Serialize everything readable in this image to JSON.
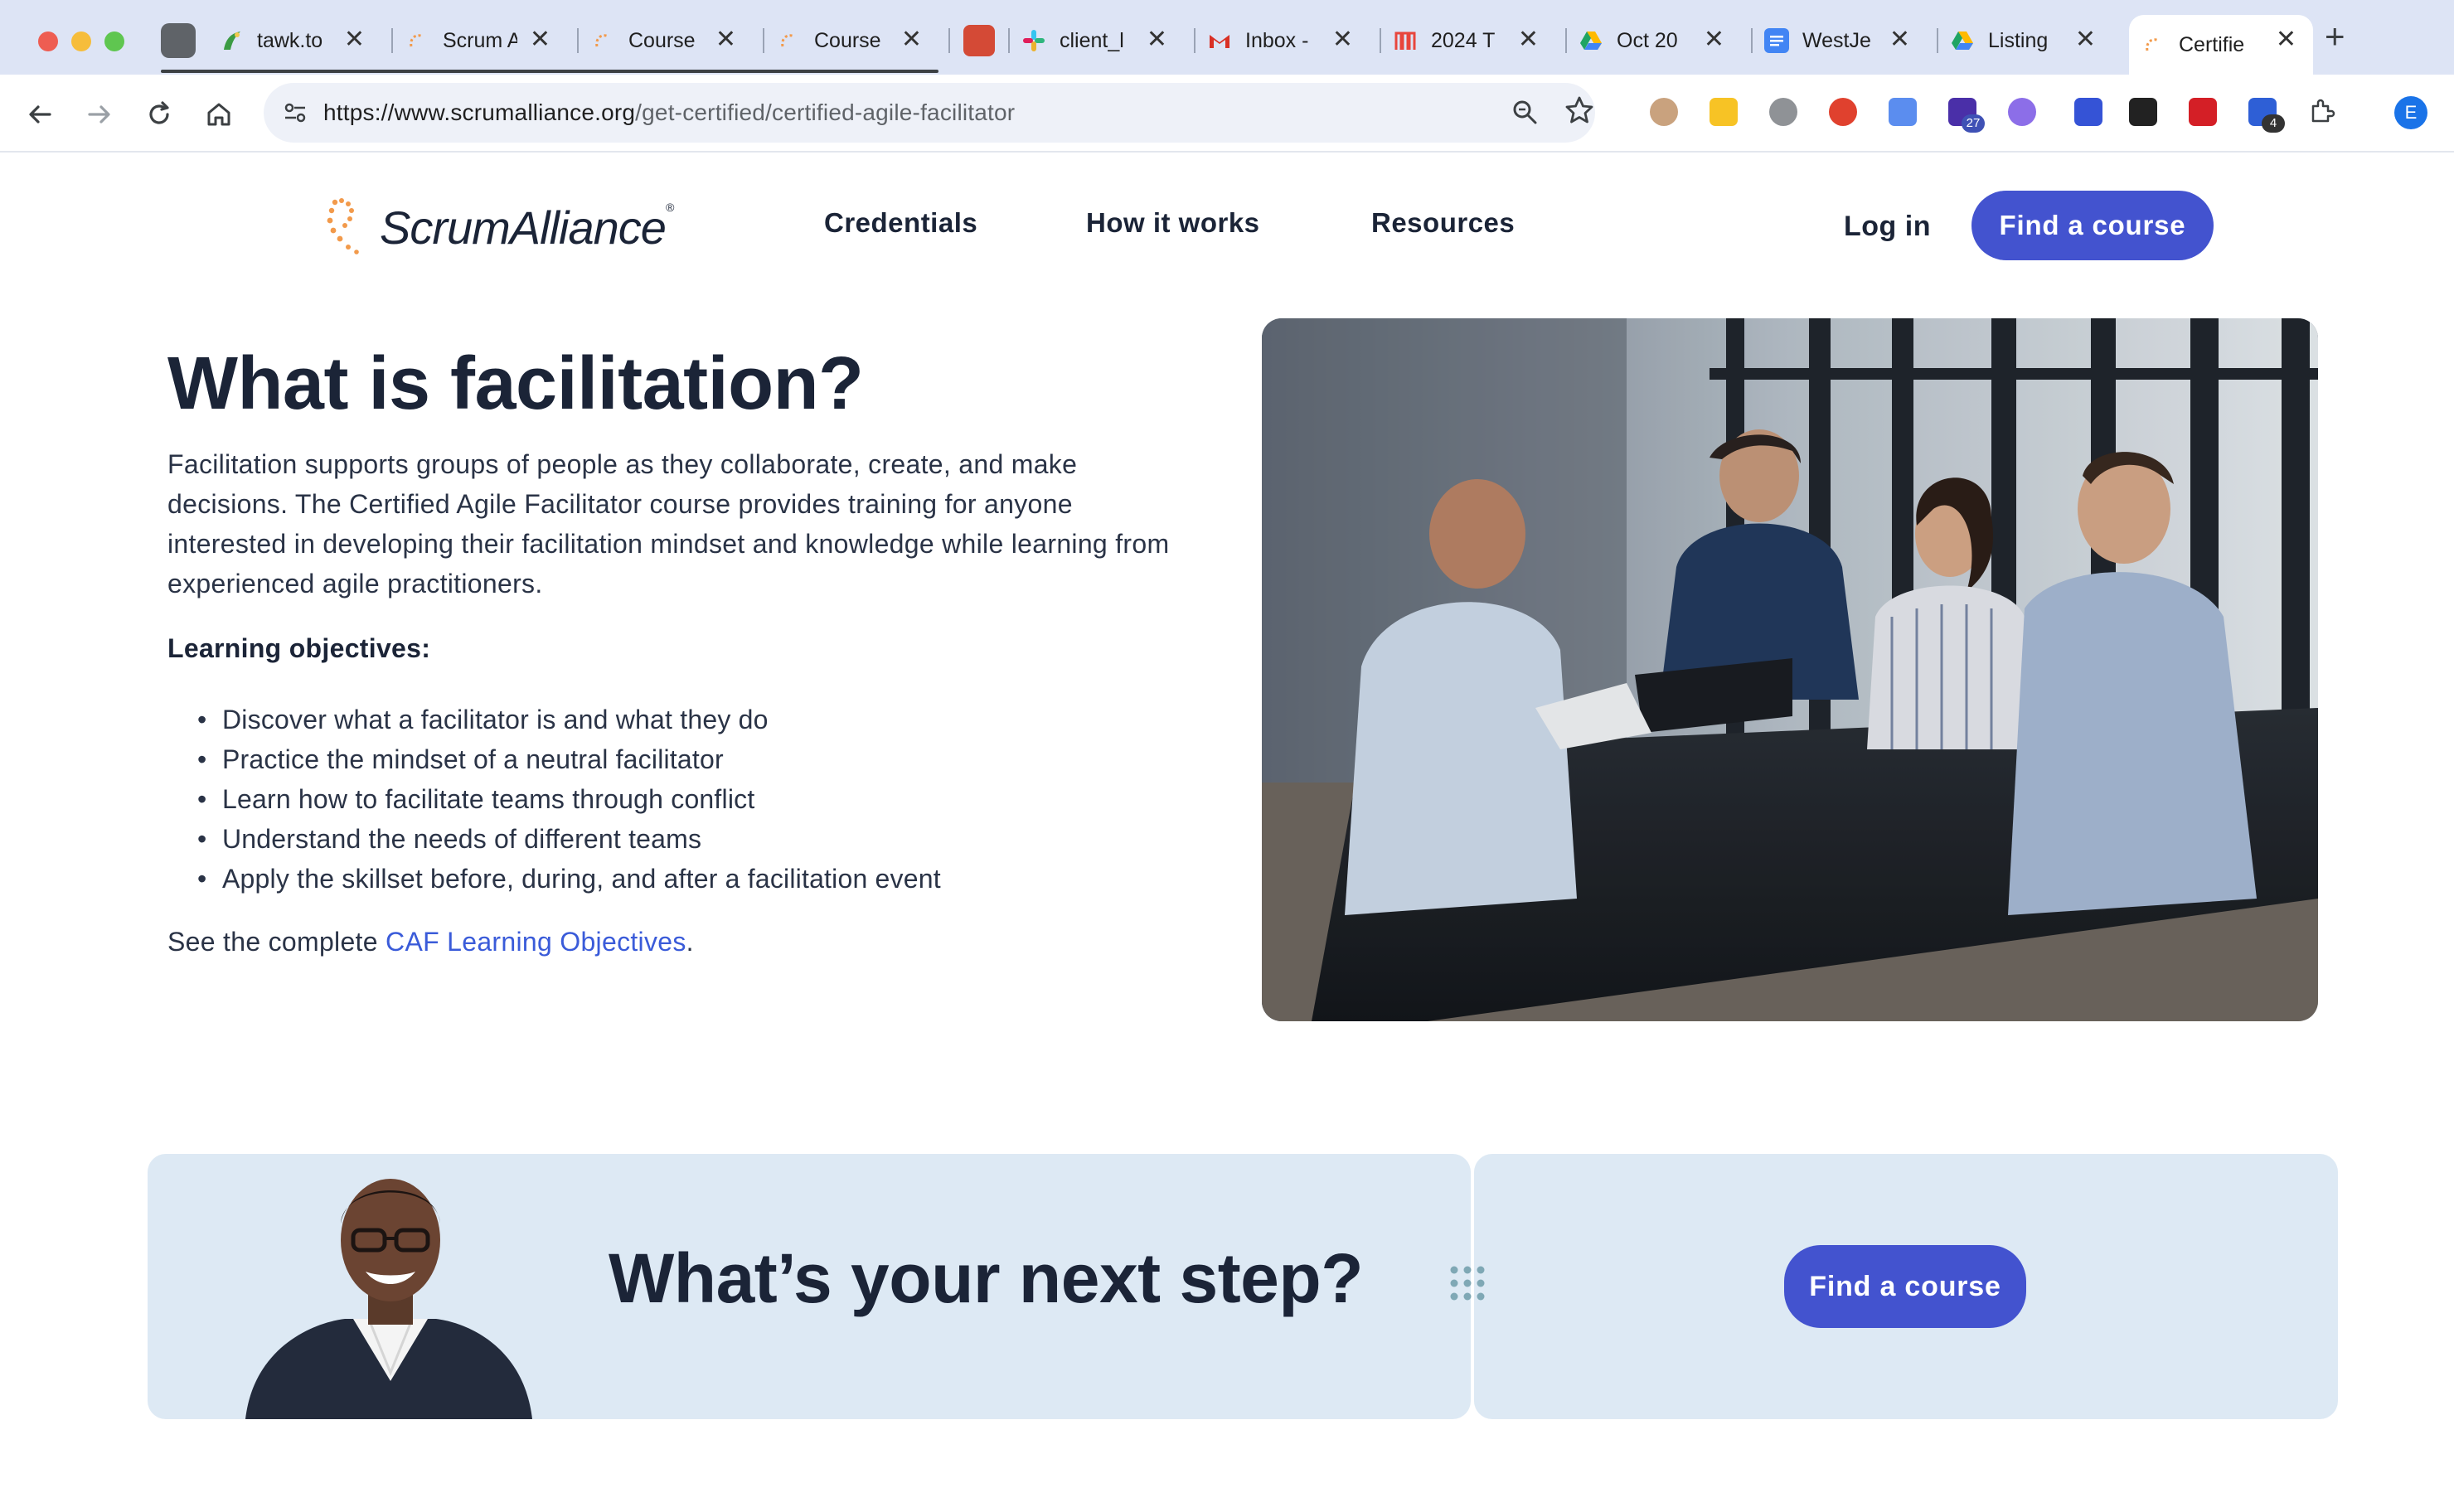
{
  "browser": {
    "tabs": [
      {
        "title": "tawk.to",
        "favicon": "tawk-icon",
        "color": "#3b9b43"
      },
      {
        "title": "Scrum A",
        "favicon": "scrumalliance-icon",
        "color": "#f29a4b"
      },
      {
        "title": "Course",
        "favicon": "scrumalliance-icon",
        "color": "#f29a4b"
      },
      {
        "title": "Course",
        "favicon": "scrumalliance-icon",
        "color": "#f29a4b"
      },
      {
        "title": "client_l",
        "favicon": "slack-icon",
        "color": "#e01e5a"
      },
      {
        "title": "Inbox -",
        "favicon": "gmail-icon",
        "color": "#d93025"
      },
      {
        "title": "2024 T",
        "favicon": "miro-icon",
        "color": "#e8453c"
      },
      {
        "title": "Oct 20",
        "favicon": "google-drive-icon",
        "color": "#1fa463"
      },
      {
        "title": "WestJe",
        "favicon": "google-docs-icon",
        "color": "#4285f4"
      },
      {
        "title": "Listing",
        "favicon": "google-drive-icon",
        "color": "#1fa463"
      },
      {
        "title": "Certifie",
        "favicon": "scrumalliance-icon",
        "color": "#f29a4b"
      }
    ],
    "active_tab_index": 10,
    "url_host": "https://www.scrumalliance.org",
    "url_path": "/get-certified/certified-agile-facilitator",
    "extension_badges": {
      "ext_27": "27",
      "ext_4": "4"
    },
    "profile_initial": "E"
  },
  "site": {
    "logo_text": "ScrumAlliance",
    "logo_reg": "®",
    "nav": [
      "Credentials",
      "How it works",
      "Resources"
    ],
    "login": "Log in",
    "header_cta": "Find a course"
  },
  "hero": {
    "title": "What is facilitation?",
    "paragraph": "Facilitation supports groups of people as they collaborate, create, and make decisions. The Certified Agile Facilitator course provides training for anyone interested in developing their facilitation mindset and knowledge while learning from experienced agile practitioners.",
    "objectives_heading": "Learning objectives:",
    "objectives": [
      "Discover what a facilitator is and what they do",
      "Practice the mindset of a neutral facilitator",
      "Learn how to facilitate teams through conflict",
      "Understand the needs of different teams",
      "Apply the skillset before, during, and after a facilitation event"
    ],
    "see_prefix": "See the complete ",
    "see_link": "CAF Learning Objectives",
    "see_suffix": "."
  },
  "cta": {
    "title": "What’s your next step?",
    "button": "Find a course"
  },
  "colors": {
    "brand_blue": "#4353cf",
    "link_blue": "#3a5bd9",
    "cta_bg": "#dde9f4",
    "text_dark": "#1b2437",
    "logo_orange": "#f29a4b"
  }
}
